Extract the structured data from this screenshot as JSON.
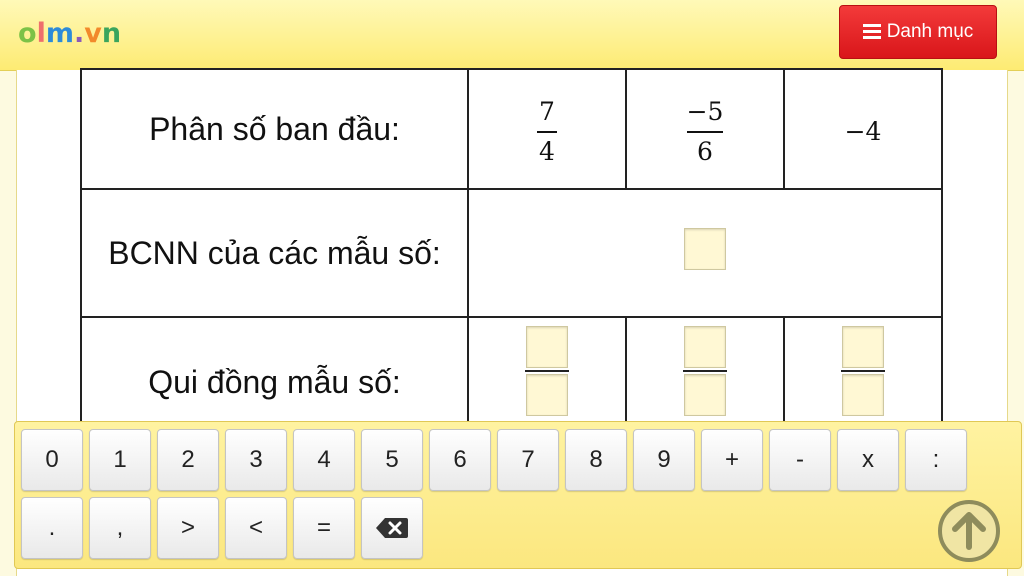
{
  "header": {
    "logo": {
      "o": "o",
      "l": "l",
      "m": "m",
      "dot": ".",
      "v": "v",
      "n": "n"
    },
    "menu_button": {
      "label": "Danh mục",
      "icon": "list-icon",
      "color": "#e8191c"
    }
  },
  "table": {
    "row1": {
      "label": "Phân số ban đầu:",
      "values": [
        {
          "numerator": "7",
          "denominator": "4"
        },
        {
          "numerator": "−5",
          "denominator": "6"
        },
        {
          "whole": "−4"
        }
      ]
    },
    "row2": {
      "label": "BCNN của các mẫu số:"
    },
    "row3": {
      "label": "Qui đồng mẫu số:"
    }
  },
  "keyboard": {
    "row1": [
      "0",
      "1",
      "2",
      "3",
      "4",
      "5",
      "6",
      "7",
      "8",
      "9",
      "+",
      "-",
      "x",
      ":"
    ],
    "row2": [
      ".",
      ",",
      ">",
      "<",
      "="
    ],
    "backspace_icon": "backspace-icon",
    "scroll_up_icon": "arrow-up-circle-icon"
  },
  "colors": {
    "header_bg": "#fdeb73",
    "input_box_bg": "#fff8d4",
    "keyboard_bg": "#fbe77f"
  }
}
